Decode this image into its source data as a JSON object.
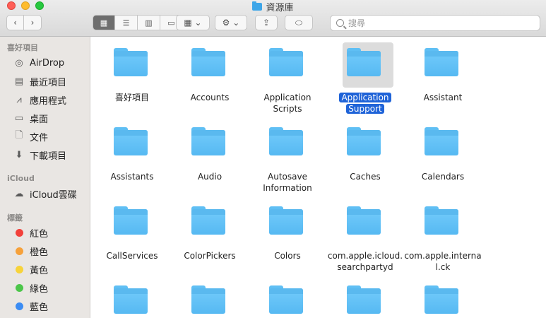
{
  "window": {
    "title": "資源庫"
  },
  "toolbar": {
    "back": "‹",
    "forward": "›",
    "views": [
      "▦",
      "☰",
      "▥",
      "▭"
    ],
    "group": "▦ ⌄",
    "action": "⚙ ⌄",
    "share": "⇪",
    "tag": "⬭"
  },
  "search": {
    "placeholder": "搜尋"
  },
  "sidebar": {
    "favorites_heading": "喜好項目",
    "favorites": [
      "AirDrop",
      "最近項目",
      "應用程式",
      "桌面",
      "文件",
      "下載項目"
    ],
    "icloud_heading": "iCloud",
    "icloud": [
      "iCloud雲碟"
    ],
    "tags_heading": "標籤",
    "tags": [
      {
        "label": "紅色",
        "color": "#f2413a"
      },
      {
        "label": "橙色",
        "color": "#f6a13a"
      },
      {
        "label": "黃色",
        "color": "#f7d33a"
      },
      {
        "label": "綠色",
        "color": "#4cc64a"
      },
      {
        "label": "藍色",
        "color": "#3b8cf3"
      }
    ]
  },
  "folders": [
    [
      "喜好項目"
    ],
    [
      "Accounts"
    ],
    [
      "Application",
      "Scripts"
    ],
    [
      "Application",
      "Support"
    ],
    [
      "Assistant"
    ],
    [
      "Assistants"
    ],
    [
      "Audio"
    ],
    [
      "Autosave",
      "Information"
    ],
    [
      "Caches"
    ],
    [
      "Calendars"
    ],
    [
      "CallServices"
    ],
    [
      "ColorPickers"
    ],
    [
      "Colors"
    ],
    [
      "com.apple.icloud.",
      "searchpartyd"
    ],
    [
      "com.apple.interna",
      "l.ck"
    ]
  ],
  "selected_folder": "Application Support"
}
